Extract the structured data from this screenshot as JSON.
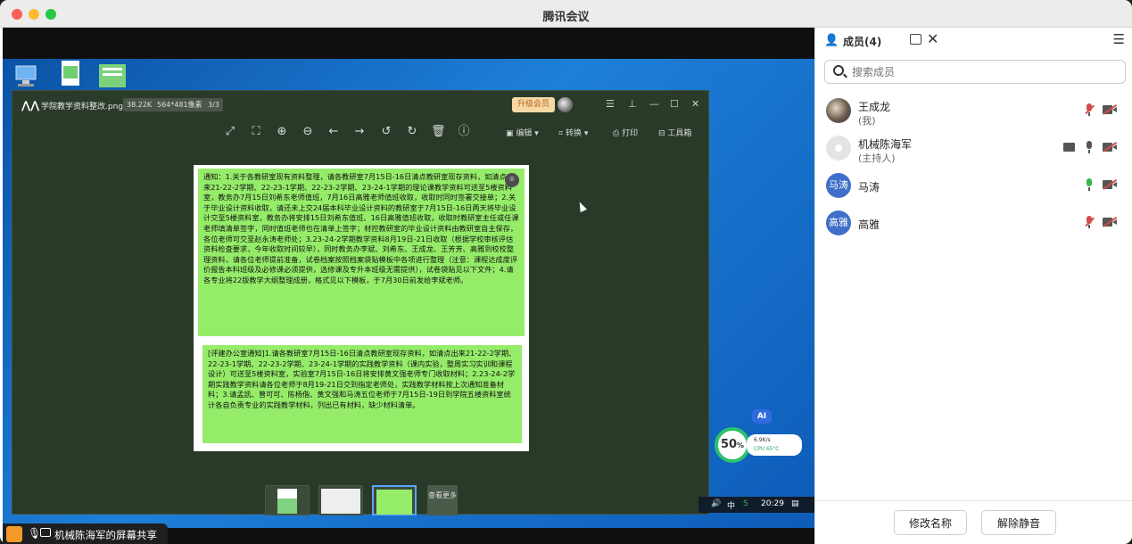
{
  "window": {
    "title": "腾讯会议"
  },
  "viewer": {
    "filename": "学院教学资料整改.png",
    "filesize": "38.22K",
    "dimensions": "564*481像素",
    "page": "3/3",
    "vip_label": "升级会员",
    "tools": {
      "edit": "编辑",
      "convert": "转换",
      "print": "打印",
      "toolbox": "工具箱"
    },
    "more_label": "查看更多"
  },
  "doc": {
    "message1": "通知：1.关于各教研室现有资料整理，请各教研室7月15日-16日清点教研室现存资料，如清点出来21-22-2学期、22-23-1学期、22-23-2学期、23-24-1学期的理论课教学资料可送至5楼资料室，教务办7月15日刘希东老师值班，7月16日高雅老师值班收取，收取时同时签署交接单；2.关于毕业设计资料收取，请还未上交24届本科毕业设计资料的教研室于7月15日-16日两天将毕业设计交至5楼资料室，教务办将安排15日刘希东值班、16日高雅值班收取，收取时教研室主任或任课老师填清单签字，同时值班老师也在清单上签字；材控教研室的毕业设计资料由教研室自主保存，各位老师可交至赵永涛老师处；3.23-24-2学期教学资料8月19日-21日收取（根据学校审核评估资料检查要求，今年收取时间较早），同时教务办李斌、刘希东、王成龙、王芳芳、高雅到校校整理资料，请各位老师提前准备，试卷档案按照档案袋贴模板中各项进行整理（注意：课程达成度评价报告本科班级及必修课必须提供，选修课及专升本班级无需提供），试卷袋贴见以下文件；4.请各专业将22版教学大纲整理成册，格式见以下模板，于7月30日前发给李斌老师。",
    "message2": "[评建办公室通知]1.请各教研室7月15日-16日清点教研室现存资料，如清点出来21-22-2学期、22-23-1学期、22-23-2学期、23-24-1学期的实践教学资料（课内实验，整周实习实训和课程设计）可送至5楼资料室，实验室7月15日-16日将安排黄文强老师专门收取材料；2.23-24-2学期实践教学资料请各位老师于8月19-21日交到指定老师处，实践教学材料按上次通知准备材料；3.请孟凯、曾可可、陈杨偕、黄文强和马涛五位老师于7月15日-19日到学院五楼资料室统计各自负责专业的实践教学材料，列出已有材料，缺少材料清单。"
  },
  "taskbar": {
    "ime": "中",
    "time": "20:29"
  },
  "perf": {
    "percent": "50",
    "unit": "%",
    "speed": "6.9K/s",
    "cpu": "CPU 65℃",
    "ai_label": "AI"
  },
  "share_bar": {
    "label": "机械陈海军的屏幕共享"
  },
  "panel": {
    "title": "成员(4)",
    "search_placeholder": "搜索成员",
    "members": [
      {
        "name": "王成龙",
        "role": "(我)",
        "avatar_text": "",
        "mic": "muted",
        "cam": "off"
      },
      {
        "name": "机械陈海军",
        "role": "(主持人)",
        "avatar_text": "",
        "mic": "on",
        "cam": "off",
        "sharing": true
      },
      {
        "name": "马涛",
        "role": "",
        "avatar_text": "马涛",
        "mic": "speaking",
        "cam": "off"
      },
      {
        "name": "高雅",
        "role": "",
        "avatar_text": "高雅",
        "mic": "muted",
        "cam": "off"
      }
    ],
    "rename_button": "修改名称",
    "unmute_button": "解除静音"
  },
  "colors": {
    "accent": "#2f6bde",
    "chat_bubble": "#95ec69",
    "avatar_blue": "#3f6fc8",
    "muted_red": "#d34b4b",
    "speaking_green": "#3cb54a"
  }
}
